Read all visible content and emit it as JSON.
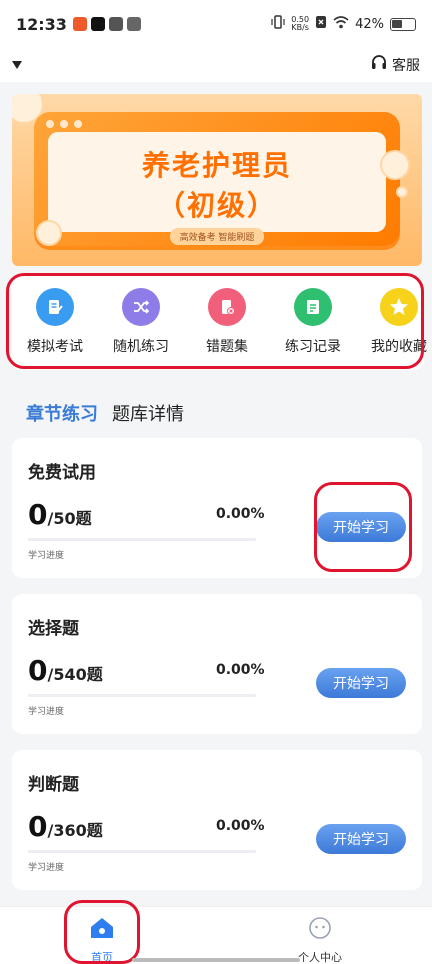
{
  "status_bar": {
    "time": "12:33",
    "net_speed_value": "0.50",
    "net_speed_unit": "KB/s",
    "battery": "42%"
  },
  "header": {
    "service_label": "客服",
    "service_icon": "headset-icon",
    "dropdown_icon": "caret-down-icon"
  },
  "banner": {
    "title_line1": "养老护理员",
    "title_line2": "（初级）",
    "tagline": "高效备考 智能刷题"
  },
  "shortcuts": [
    {
      "label": "模拟考试",
      "icon": "exam-icon",
      "color": "#3a9cf0"
    },
    {
      "label": "随机练习",
      "icon": "shuffle-icon",
      "color": "#8e7ce8"
    },
    {
      "label": "错题集",
      "icon": "wrong-book-icon",
      "color": "#f25f7a"
    },
    {
      "label": "练习记录",
      "icon": "record-icon",
      "color": "#2fbf71"
    },
    {
      "label": "我的收藏",
      "icon": "star-icon",
      "color": "#f7d21b"
    }
  ],
  "tabs": [
    {
      "label": "章节练习",
      "active": true
    },
    {
      "label": "题库详情",
      "active": false
    }
  ],
  "cards": [
    {
      "title": "免费试用",
      "done": "0",
      "total": "/50题",
      "percent": "0.00%",
      "progress": 0,
      "sub": "学习进度",
      "button": "开始学习"
    },
    {
      "title": "选择题",
      "done": "0",
      "total": "/540题",
      "percent": "0.00%",
      "progress": 0,
      "sub": "学习进度",
      "button": "开始学习"
    },
    {
      "title": "判断题",
      "done": "0",
      "total": "/360题",
      "percent": "0.00%",
      "progress": 0,
      "sub": "学习进度",
      "button": "开始学习"
    }
  ],
  "bottom_nav": [
    {
      "label": "首页",
      "icon": "home-icon",
      "active": true
    },
    {
      "label": "个人中心",
      "icon": "profile-icon",
      "active": false
    }
  ],
  "colors": {
    "accent": "#3a7bd5",
    "highlight_box": "#e0142e",
    "banner_orange": "#ff7b00"
  }
}
